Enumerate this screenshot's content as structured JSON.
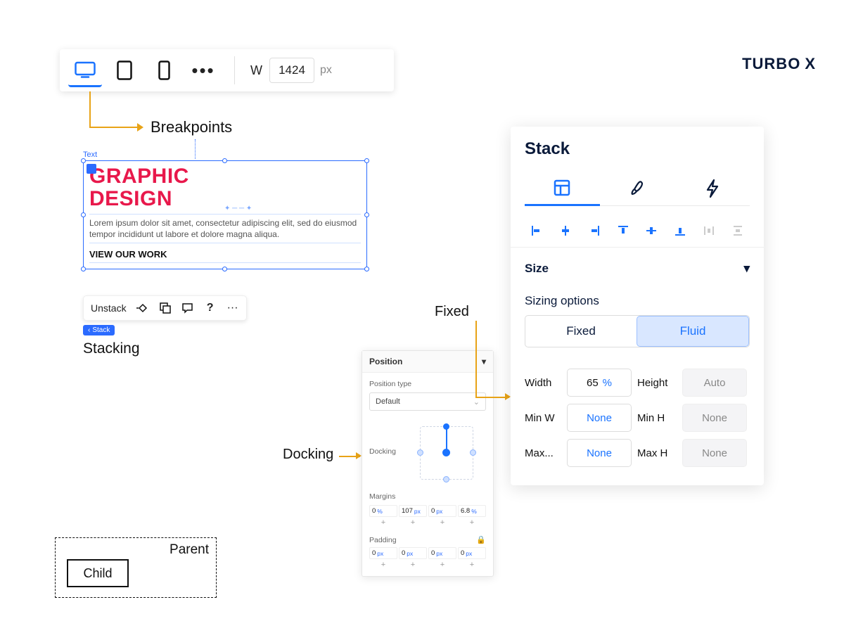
{
  "brand": {
    "name": "TURBO",
    "suffix": "X"
  },
  "breakpointToolbar": {
    "widthLabel": "W",
    "widthValue": "1424",
    "widthUnit": "px"
  },
  "callouts": {
    "breakpoints": "Breakpoints",
    "stacking": "Stacking",
    "docking": "Docking",
    "fixed": "Fixed",
    "fluid": "Fluid"
  },
  "canvas": {
    "tag": "Text",
    "title1": "GRAPHIC",
    "title2": "DESIGN",
    "body": "Lorem ipsum dolor sit amet, consectetur adipiscing elit, sed do eiusmod tempor incididunt ut labore et dolore magna aliqua.",
    "cta": "VIEW OUR WORK"
  },
  "unstackToolbar": {
    "unstack": "Unstack",
    "stackChip": "Stack",
    "more": "···"
  },
  "parentChild": {
    "parent": "Parent",
    "child": "Child"
  },
  "positionPanel": {
    "header": "Position",
    "positionTypeLabel": "Position type",
    "positionTypeValue": "Default",
    "dockingLabel": "Docking",
    "marginsLabel": "Margins",
    "paddingLabel": "Padding",
    "margins": [
      {
        "v": "0",
        "u": "%"
      },
      {
        "v": "107",
        "u": "px"
      },
      {
        "v": "0",
        "u": "px"
      },
      {
        "v": "6.8",
        "u": "%"
      }
    ],
    "padding": [
      {
        "v": "0",
        "u": "px"
      },
      {
        "v": "0",
        "u": "px"
      },
      {
        "v": "0",
        "u": "px"
      },
      {
        "v": "0",
        "u": "px"
      }
    ]
  },
  "stackPanel": {
    "title": "Stack",
    "sizeHeader": "Size",
    "sizingOptions": "Sizing options",
    "segFixed": "Fixed",
    "segFluid": "Fluid",
    "rows": {
      "widthLabel": "Width",
      "widthVal": "65",
      "widthUnit": "%",
      "heightLabel": "Height",
      "heightVal": "Auto",
      "minWLabel": "Min W",
      "minWVal": "None",
      "minHLabel": "Min H",
      "minHVal": "None",
      "maxWLabel": "Max...",
      "maxWVal": "None",
      "maxHLabel": "Max H",
      "maxHVal": "None"
    }
  }
}
